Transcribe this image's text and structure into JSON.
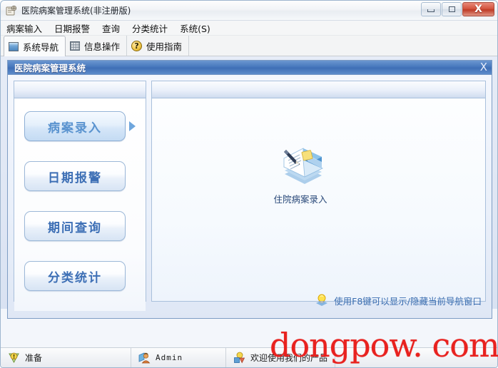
{
  "window": {
    "title": "医院病案管理系统(非注册版)",
    "app_icon": "app-icon",
    "buttons": {
      "minimize": "minimize-icon",
      "maximize": "restore-icon",
      "close": "X"
    }
  },
  "menu": {
    "items": [
      {
        "label": "病案输入"
      },
      {
        "label": "日期报警"
      },
      {
        "label": "查询"
      },
      {
        "label": "分类统计"
      },
      {
        "label": "系统(S)"
      }
    ]
  },
  "toolbar": {
    "tabs": [
      {
        "label": "系统导航",
        "icon": "navigation-icon",
        "active": true
      },
      {
        "label": "信息操作",
        "icon": "grid-icon",
        "active": false
      },
      {
        "label": "使用指南",
        "icon": "help-icon",
        "active": false
      }
    ],
    "help_glyph": "?"
  },
  "mdi": {
    "title": "医院病案管理系统",
    "close_glyph": "X"
  },
  "nav_panel": {
    "buttons": [
      {
        "label": "病案录入",
        "selected": true,
        "has_arrow": true
      },
      {
        "label": "日期报警",
        "selected": false,
        "has_arrow": false
      },
      {
        "label": "期间查询",
        "selected": false,
        "has_arrow": false
      },
      {
        "label": "分类统计",
        "selected": false,
        "has_arrow": false
      }
    ]
  },
  "content_panel": {
    "items": [
      {
        "label": "住院病案录入",
        "icon": "document-pen-icon"
      }
    ]
  },
  "hint": {
    "icon": "lightbulb-icon",
    "text": "使用F8键可以显示/隐藏当前导航窗口"
  },
  "status_bar": {
    "cells": [
      {
        "icon": "ready-icon",
        "text": "准备"
      },
      {
        "icon": "user-icon",
        "text": "Admin"
      },
      {
        "icon": "product-icon",
        "text": "欢迎使用我们的产品"
      }
    ]
  },
  "watermark": {
    "text": "dongpow. com"
  },
  "colors": {
    "accent_blue": "#3d6fb5",
    "mdi_title_blue": "#4c7cc0",
    "close_red": "#bf3b26",
    "watermark_red": "#e8221f",
    "hint_text": "#3a6db0"
  }
}
